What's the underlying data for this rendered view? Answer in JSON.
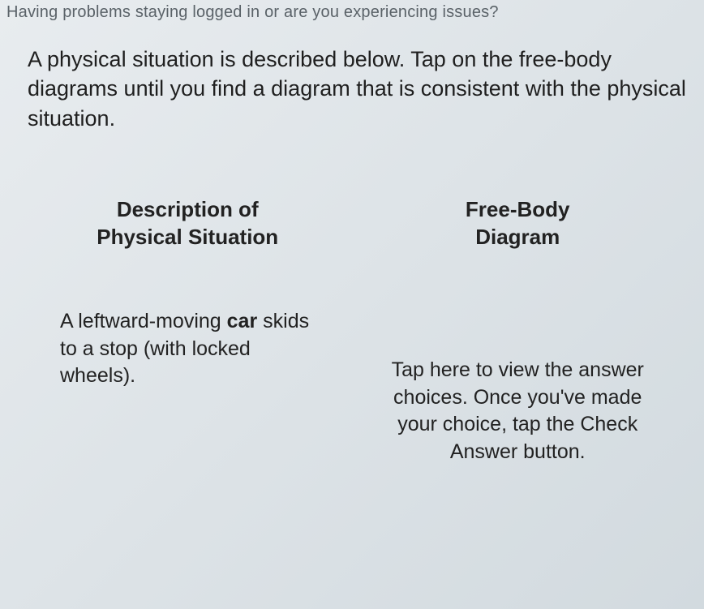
{
  "banner": {
    "text": "Having problems staying logged in or are you experiencing issues?"
  },
  "instructions": "A physical situation is described below. Tap on the free-body diagrams until you find a diagram that is consistent with the physical situation.",
  "left": {
    "header_line1": "Description of",
    "header_line2": "Physical Situation",
    "situation_pre": "A leftward-moving ",
    "situation_bold": "car",
    "situation_post": " skids to a stop (with locked wheels)."
  },
  "right": {
    "header_line1": "Free-Body",
    "header_line2": "Diagram",
    "answer_prompt": "Tap here to view the answer choices. Once you've made your choice, tap the Check Answer button."
  }
}
